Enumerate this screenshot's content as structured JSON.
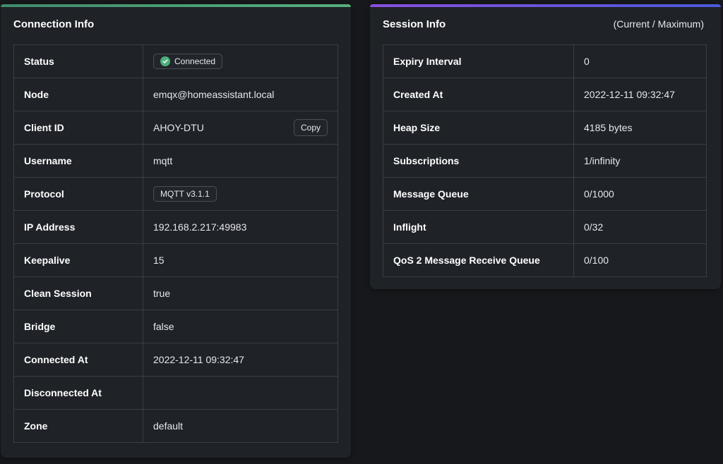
{
  "connection_info": {
    "title": "Connection Info",
    "rows": {
      "status": {
        "label": "Status",
        "value": "Connected"
      },
      "node": {
        "label": "Node",
        "value": "emqx@homeassistant.local"
      },
      "client_id": {
        "label": "Client ID",
        "value": "AHOY-DTU",
        "copy_label": "Copy"
      },
      "username": {
        "label": "Username",
        "value": "mqtt"
      },
      "protocol": {
        "label": "Protocol",
        "value": "MQTT v3.1.1"
      },
      "ip_address": {
        "label": "IP Address",
        "value": "192.168.2.217:49983"
      },
      "keepalive": {
        "label": "Keepalive",
        "value": "15"
      },
      "clean_session": {
        "label": "Clean Session",
        "value": "true"
      },
      "bridge": {
        "label": "Bridge",
        "value": "false"
      },
      "connected_at": {
        "label": "Connected At",
        "value": "2022-12-11 09:32:47"
      },
      "disconnected_at": {
        "label": "Disconnected At",
        "value": ""
      },
      "zone": {
        "label": "Zone",
        "value": "default"
      }
    },
    "status_icon": "check-circle-icon",
    "status_color": "#4caf7d"
  },
  "session_info": {
    "title": "Session Info",
    "subtitle": "(Current / Maximum)",
    "rows": {
      "expiry_interval": {
        "label": "Expiry Interval",
        "value": "0"
      },
      "created_at": {
        "label": "Created At",
        "value": "2022-12-11 09:32:47"
      },
      "heap_size": {
        "label": "Heap Size",
        "value": "4185 bytes"
      },
      "subscriptions": {
        "label": "Subscriptions",
        "value": "1/infinity"
      },
      "message_queue": {
        "label": "Message Queue",
        "value": "0/1000"
      },
      "inflight": {
        "label": "Inflight",
        "value": "0/32"
      },
      "qos2_receive_queue": {
        "label": "QoS 2 Message Receive Queue",
        "value": "0/100"
      }
    }
  }
}
